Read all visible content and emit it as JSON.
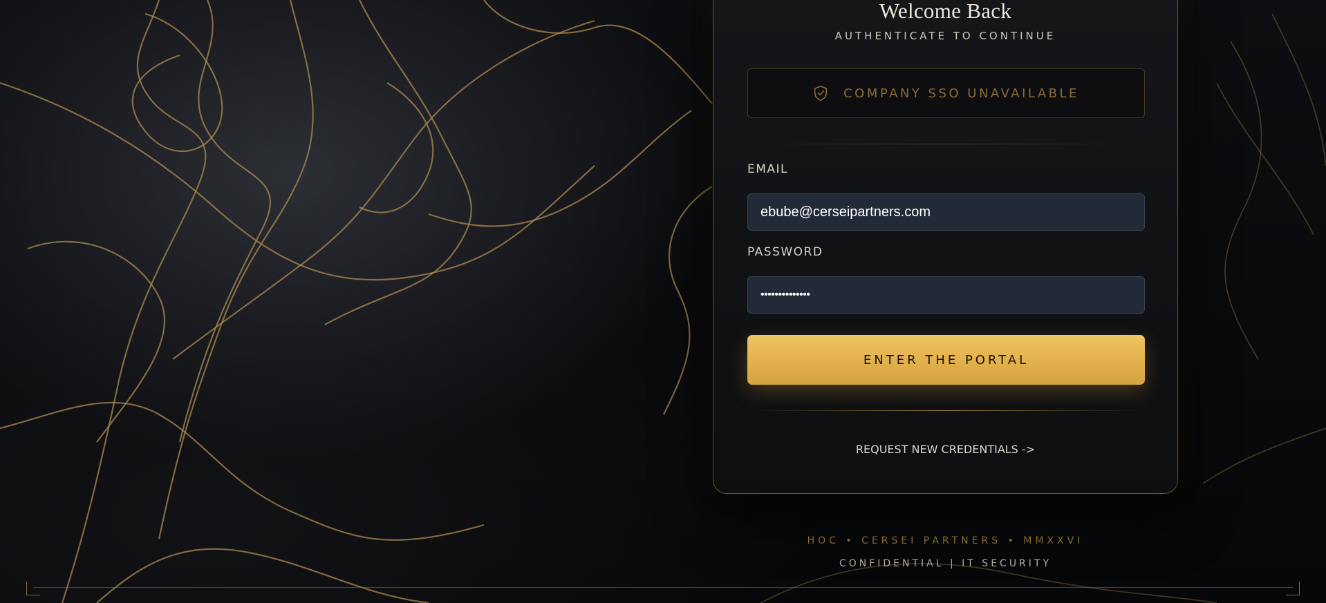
{
  "login": {
    "title": "Welcome Back",
    "subtitle": "AUTHENTICATE TO CONTINUE",
    "sso_label": "COMPANY SSO UNAVAILABLE",
    "email_label": "EMAIL",
    "email_value": "ebube@cerseipartners.com",
    "password_label": "PASSWORD",
    "password_value": "••••••••••••••",
    "submit_label": "ENTER THE PORTAL",
    "request_link": "REQUEST NEW CREDENTIALS ->"
  },
  "footer": {
    "line1": "HOC • CERSEI PARTNERS • MMXXVI",
    "line2": "CONFIDENTIAL | IT SECURITY"
  },
  "icons": {
    "sso": "shield-check-icon"
  },
  "colors": {
    "accent_gold": "#e3b24d",
    "sso_text": "#8a6c34",
    "input_bg": "#232a37",
    "card_border": "#b08a3e"
  }
}
